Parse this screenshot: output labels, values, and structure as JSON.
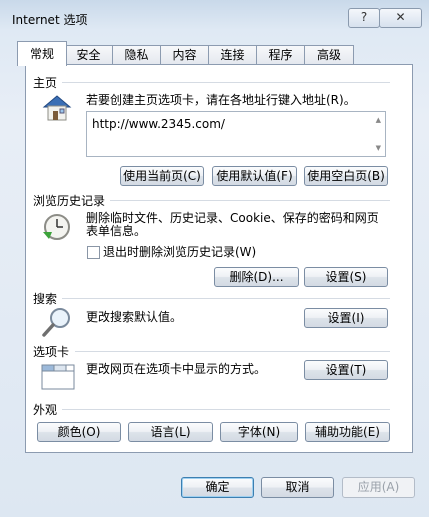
{
  "window": {
    "title": "Internet 选项",
    "help_label": "?",
    "close_label": "✕"
  },
  "tabs": [
    "常规",
    "安全",
    "隐私",
    "内容",
    "连接",
    "程序",
    "高级"
  ],
  "homepage": {
    "heading": "主页",
    "description": "若要创建主页选项卡，请在各地址行键入地址(R)。",
    "url": "http://www.2345.com/",
    "buttons": {
      "use_current": "使用当前页(C)",
      "use_default": "使用默认值(F)",
      "use_blank": "使用空白页(B)"
    }
  },
  "history": {
    "heading": "浏览历史记录",
    "description_line1": "删除临时文件、历史记录、Cookie、保存的密码和网页",
    "description_line2": "表单信息。",
    "checkbox_label": "退出时删除浏览历史记录(W)",
    "delete_button": "删除(D)...",
    "settings_button": "设置(S)"
  },
  "search": {
    "heading": "搜索",
    "description": "更改搜索默认值。",
    "settings_button": "设置(I)"
  },
  "tabs_section": {
    "heading": "选项卡",
    "description": "更改网页在选项卡中显示的方式。",
    "settings_button": "设置(T)"
  },
  "appearance": {
    "heading": "外观",
    "buttons": {
      "colors": "颜色(O)",
      "languages": "语言(L)",
      "fonts": "字体(N)",
      "accessibility": "辅助功能(E)"
    }
  },
  "footer": {
    "ok": "确定",
    "cancel": "取消",
    "apply": "应用(A)"
  }
}
